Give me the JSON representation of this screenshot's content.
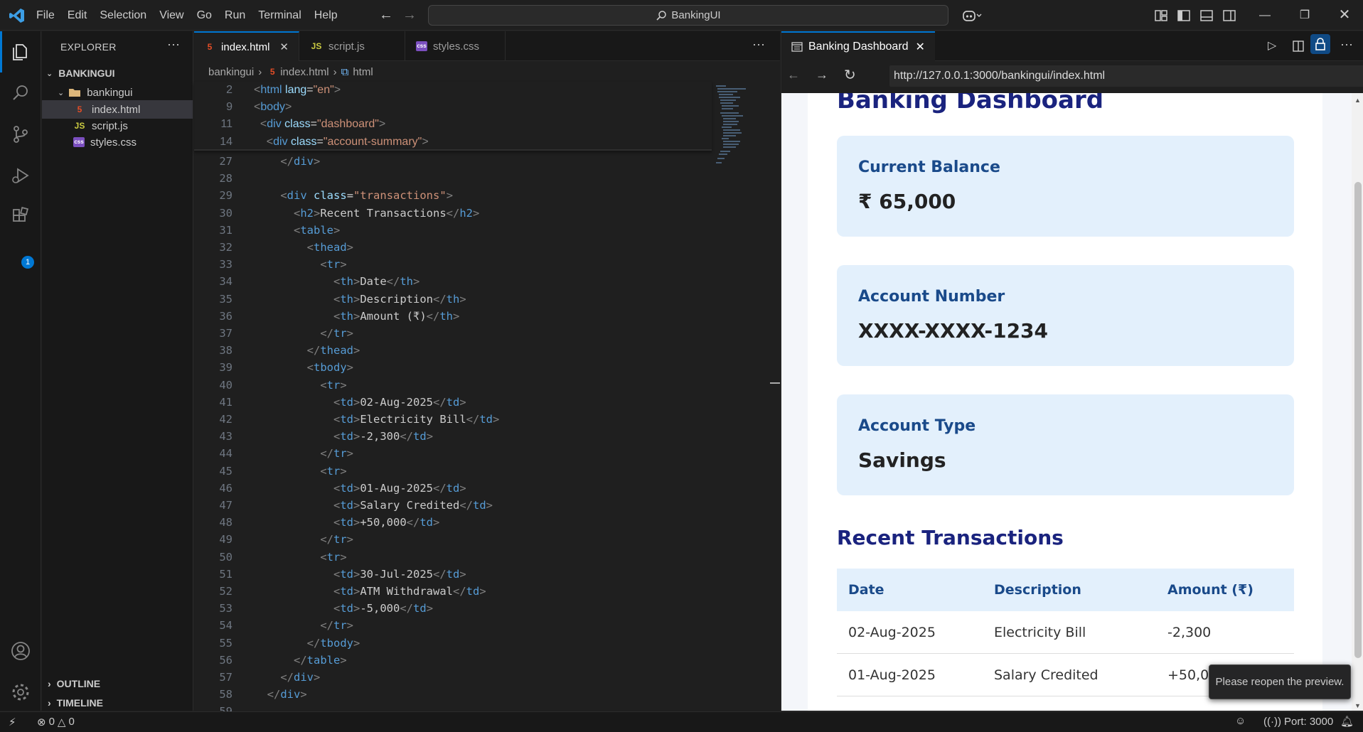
{
  "titlebar": {
    "menu": [
      "File",
      "Edit",
      "Selection",
      "View",
      "Go",
      "Run",
      "Terminal",
      "Help"
    ],
    "search": "BankingUI"
  },
  "sidebar": {
    "title": "EXPLORER",
    "root": "BANKINGUI",
    "folder": "bankingui",
    "files": [
      {
        "name": "index.html",
        "icon": "5",
        "color": "#e44d26"
      },
      {
        "name": "script.js",
        "icon": "JS",
        "color": "#cbcb41"
      },
      {
        "name": "styles.css",
        "icon": "css",
        "color": "#7b4fbf"
      }
    ],
    "outline": "OUTLINE",
    "timeline": "TIMELINE"
  },
  "tabs": [
    {
      "name": "index.html",
      "icon": "5",
      "color": "#e44d26"
    },
    {
      "name": "script.js",
      "icon": "JS",
      "color": "#cbcb41"
    },
    {
      "name": "styles.css",
      "icon": "css",
      "color": "#7b4fbf"
    }
  ],
  "breadcrumb": [
    "bankingui",
    "index.html",
    "html"
  ],
  "sticky_lines": [
    {
      "n": "2",
      "html": "<span class='b'>&lt;</span><span class='t'>html</span> <span class='a'>lang</span><span class='x'>=</span><span class='s'>\"en\"</span><span class='b'>&gt;</span>"
    },
    {
      "n": "9",
      "html": "<span class='b'>&lt;</span><span class='t'>body</span><span class='b'>&gt;</span>"
    },
    {
      "n": "11",
      "html": "  <span class='b'>&lt;</span><span class='t'>div</span> <span class='a'>class</span><span class='x'>=</span><span class='s'>\"dashboard\"</span><span class='b'>&gt;</span>"
    },
    {
      "n": "14",
      "html": "    <span class='b'>&lt;</span><span class='t'>div</span> <span class='a'>class</span><span class='x'>=</span><span class='s'>\"account-summary\"</span><span class='b'>&gt;</span>"
    }
  ],
  "code_lines": [
    {
      "n": "27",
      "html": "    <span class='b'>&lt;/</span><span class='t'>div</span><span class='b'>&gt;</span>"
    },
    {
      "n": "28",
      "html": ""
    },
    {
      "n": "29",
      "html": "    <span class='b'>&lt;</span><span class='t'>div</span> <span class='a'>class</span><span class='x'>=</span><span class='s'>\"transactions\"</span><span class='b'>&gt;</span>"
    },
    {
      "n": "30",
      "html": "      <span class='b'>&lt;</span><span class='t'>h2</span><span class='b'>&gt;</span>Recent Transactions<span class='b'>&lt;/</span><span class='t'>h2</span><span class='b'>&gt;</span>"
    },
    {
      "n": "31",
      "html": "      <span class='b'>&lt;</span><span class='t'>table</span><span class='b'>&gt;</span>"
    },
    {
      "n": "32",
      "html": "        <span class='b'>&lt;</span><span class='t'>thead</span><span class='b'>&gt;</span>"
    },
    {
      "n": "33",
      "html": "          <span class='b'>&lt;</span><span class='t'>tr</span><span class='b'>&gt;</span>"
    },
    {
      "n": "34",
      "html": "            <span class='b'>&lt;</span><span class='t'>th</span><span class='b'>&gt;</span>Date<span class='b'>&lt;/</span><span class='t'>th</span><span class='b'>&gt;</span>"
    },
    {
      "n": "35",
      "html": "            <span class='b'>&lt;</span><span class='t'>th</span><span class='b'>&gt;</span>Description<span class='b'>&lt;/</span><span class='t'>th</span><span class='b'>&gt;</span>"
    },
    {
      "n": "36",
      "html": "            <span class='b'>&lt;</span><span class='t'>th</span><span class='b'>&gt;</span>Amount (₹)<span class='b'>&lt;/</span><span class='t'>th</span><span class='b'>&gt;</span>"
    },
    {
      "n": "37",
      "html": "          <span class='b'>&lt;/</span><span class='t'>tr</span><span class='b'>&gt;</span>"
    },
    {
      "n": "38",
      "html": "        <span class='b'>&lt;/</span><span class='t'>thead</span><span class='b'>&gt;</span>"
    },
    {
      "n": "39",
      "html": "        <span class='b'>&lt;</span><span class='t'>tbody</span><span class='b'>&gt;</span>"
    },
    {
      "n": "40",
      "html": "          <span class='b'>&lt;</span><span class='t'>tr</span><span class='b'>&gt;</span>"
    },
    {
      "n": "41",
      "html": "            <span class='b'>&lt;</span><span class='t'>td</span><span class='b'>&gt;</span>02-Aug-2025<span class='b'>&lt;/</span><span class='t'>td</span><span class='b'>&gt;</span>"
    },
    {
      "n": "42",
      "html": "            <span class='b'>&lt;</span><span class='t'>td</span><span class='b'>&gt;</span>Electricity Bill<span class='b'>&lt;/</span><span class='t'>td</span><span class='b'>&gt;</span>"
    },
    {
      "n": "43",
      "html": "            <span class='b'>&lt;</span><span class='t'>td</span><span class='b'>&gt;</span>-2,300<span class='b'>&lt;/</span><span class='t'>td</span><span class='b'>&gt;</span>"
    },
    {
      "n": "44",
      "html": "          <span class='b'>&lt;/</span><span class='t'>tr</span><span class='b'>&gt;</span>"
    },
    {
      "n": "45",
      "html": "          <span class='b'>&lt;</span><span class='t'>tr</span><span class='b'>&gt;</span>"
    },
    {
      "n": "46",
      "html": "            <span class='b'>&lt;</span><span class='t'>td</span><span class='b'>&gt;</span>01-Aug-2025<span class='b'>&lt;/</span><span class='t'>td</span><span class='b'>&gt;</span>"
    },
    {
      "n": "47",
      "html": "            <span class='b'>&lt;</span><span class='t'>td</span><span class='b'>&gt;</span>Salary Credited<span class='b'>&lt;/</span><span class='t'>td</span><span class='b'>&gt;</span>"
    },
    {
      "n": "48",
      "html": "            <span class='b'>&lt;</span><span class='t'>td</span><span class='b'>&gt;</span>+50,000<span class='b'>&lt;/</span><span class='t'>td</span><span class='b'>&gt;</span>"
    },
    {
      "n": "49",
      "html": "          <span class='b'>&lt;/</span><span class='t'>tr</span><span class='b'>&gt;</span>"
    },
    {
      "n": "50",
      "html": "          <span class='b'>&lt;</span><span class='t'>tr</span><span class='b'>&gt;</span>"
    },
    {
      "n": "51",
      "html": "            <span class='b'>&lt;</span><span class='t'>td</span><span class='b'>&gt;</span>30-Jul-2025<span class='b'>&lt;/</span><span class='t'>td</span><span class='b'>&gt;</span>"
    },
    {
      "n": "52",
      "html": "            <span class='b'>&lt;</span><span class='t'>td</span><span class='b'>&gt;</span>ATM Withdrawal<span class='b'>&lt;/</span><span class='t'>td</span><span class='b'>&gt;</span>"
    },
    {
      "n": "53",
      "html": "            <span class='b'>&lt;</span><span class='t'>td</span><span class='b'>&gt;</span>-5,000<span class='b'>&lt;/</span><span class='t'>td</span><span class='b'>&gt;</span>"
    },
    {
      "n": "54",
      "html": "          <span class='b'>&lt;/</span><span class='t'>tr</span><span class='b'>&gt;</span>"
    },
    {
      "n": "55",
      "html": "        <span class='b'>&lt;/</span><span class='t'>tbody</span><span class='b'>&gt;</span>"
    },
    {
      "n": "56",
      "html": "      <span class='b'>&lt;/</span><span class='t'>table</span><span class='b'>&gt;</span>"
    },
    {
      "n": "57",
      "html": "    <span class='b'>&lt;/</span><span class='t'>div</span><span class='b'>&gt;</span>"
    },
    {
      "n": "58",
      "html": "  <span class='b'>&lt;/</span><span class='t'>div</span><span class='b'>&gt;</span>"
    },
    {
      "n": "59",
      "html": ""
    }
  ],
  "preview": {
    "tab": "Banking Dashboard",
    "url": "http://127.0.0.1:3000/bankingui/index.html",
    "heading": "Banking Dashboard",
    "cards": [
      {
        "label": "Current Balance",
        "value": "₹ 65,000"
      },
      {
        "label": "Account Number",
        "value": "XXXX-XXXX-1234"
      },
      {
        "label": "Account Type",
        "value": "Savings"
      }
    ],
    "transactions_title": "Recent Transactions",
    "table_head": [
      "Date",
      "Description",
      "Amount (₹)"
    ],
    "table_rows": [
      [
        "02-Aug-2025",
        "Electricity Bill",
        "-2,300"
      ],
      [
        "01-Aug-2025",
        "Salary Credited",
        "+50,000"
      ]
    ],
    "toast": "Please reopen the preview."
  },
  "status": {
    "errors": "0",
    "warnings": "0",
    "port": "Port: 3000"
  }
}
